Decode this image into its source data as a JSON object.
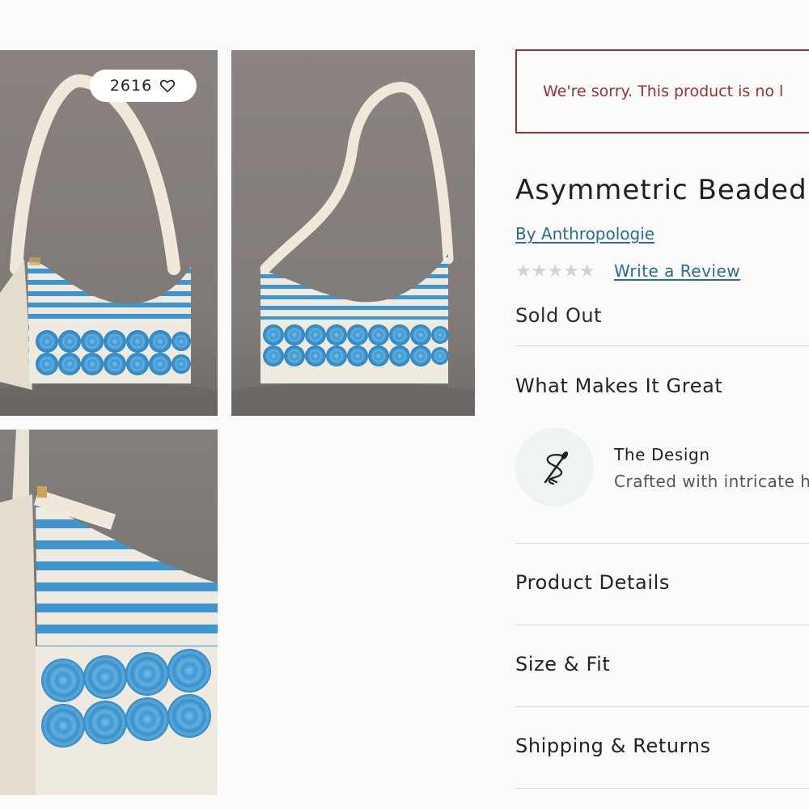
{
  "gallery": {
    "likes_count": "2616",
    "icons": {
      "likes": "heart-icon"
    }
  },
  "product": {
    "notice": "We're sorry. This product is no l",
    "title": "Asymmetric Beaded",
    "brand_link": "By Anthropologie",
    "rating_stars": "★★★★★",
    "review_link": "Write a Review",
    "stock_status": "Sold Out",
    "rating_value": 0,
    "colors": {
      "notice": "#9c2f36",
      "link": "#2a6b8e",
      "bead_blue": "#3d96cf"
    }
  },
  "sections": {
    "what_makes_it_great": "What Makes It Great",
    "feature": {
      "icon": "needle-thread-icon",
      "title": "The Design",
      "text": "Crafted with intricate h"
    },
    "product_details": "Product Details",
    "size_fit": "Size & Fit",
    "shipping_returns": "Shipping & Returns"
  }
}
